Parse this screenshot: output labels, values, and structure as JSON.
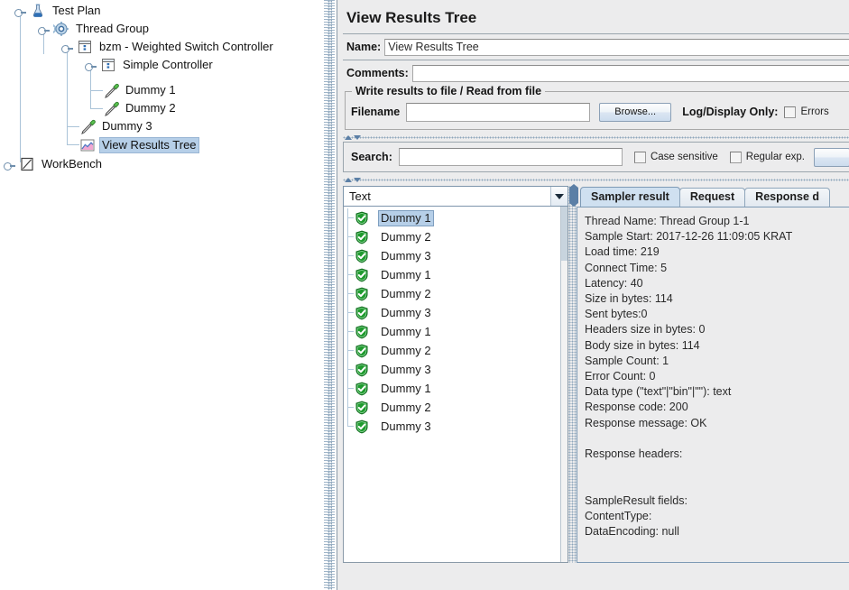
{
  "tree": {
    "nodes": [
      {
        "label": "Test Plan",
        "icon": "test-plan-icon",
        "depth": 0,
        "selected": false
      },
      {
        "label": "Thread Group",
        "icon": "thread-group-icon",
        "depth": 1,
        "selected": false
      },
      {
        "label": "bzm - Weighted Switch Controller",
        "icon": "controller-icon",
        "depth": 2,
        "selected": false
      },
      {
        "label": "Simple Controller",
        "icon": "controller-icon",
        "depth": 3,
        "selected": false
      },
      {
        "label": "Dummy  1",
        "icon": "dummy-sampler-icon",
        "depth": 4,
        "selected": false
      },
      {
        "label": "Dummy  2",
        "icon": "dummy-sampler-icon",
        "depth": 4,
        "selected": false
      },
      {
        "label": "Dummy  3",
        "icon": "dummy-sampler-icon",
        "depth": 3,
        "selected": false
      },
      {
        "label": "View Results Tree",
        "icon": "view-results-tree-icon",
        "depth": 3,
        "selected": true
      },
      {
        "label": "WorkBench",
        "icon": "workbench-icon",
        "depth": 0,
        "selected": false
      }
    ],
    "selection_color": "#b6cfe8"
  },
  "panel": {
    "title": "View Results Tree",
    "name_label": "Name:",
    "name_value": "View Results Tree",
    "comments_label": "Comments:",
    "comments_value": "",
    "file_group": {
      "title": "Write results to file / Read from file",
      "filename_label": "Filename",
      "filename_value": "",
      "browse_label": "Browse...",
      "log_display_label": "Log/Display Only:",
      "errors_label": "Errors",
      "errors_checked": false
    },
    "search": {
      "label": "Search:",
      "value": "",
      "case_sensitive_label": "Case sensitive",
      "case_sensitive_checked": false,
      "regular_exp_label": "Regular exp.",
      "regular_exp_checked": false
    },
    "renderer": {
      "selected": "Text"
    }
  },
  "results": {
    "items": [
      {
        "label": "Dummy  1",
        "status": "success",
        "selected": true
      },
      {
        "label": "Dummy  2",
        "status": "success",
        "selected": false
      },
      {
        "label": "Dummy  3",
        "status": "success",
        "selected": false
      },
      {
        "label": "Dummy  1",
        "status": "success",
        "selected": false
      },
      {
        "label": "Dummy  2",
        "status": "success",
        "selected": false
      },
      {
        "label": "Dummy  3",
        "status": "success",
        "selected": false
      },
      {
        "label": "Dummy  1",
        "status": "success",
        "selected": false
      },
      {
        "label": "Dummy  2",
        "status": "success",
        "selected": false
      },
      {
        "label": "Dummy  3",
        "status": "success",
        "selected": false
      },
      {
        "label": "Dummy  1",
        "status": "success",
        "selected": false
      },
      {
        "label": "Dummy  2",
        "status": "success",
        "selected": false
      },
      {
        "label": "Dummy  3",
        "status": "success",
        "selected": false
      }
    ]
  },
  "detail": {
    "tabs": [
      {
        "label": "Sampler result",
        "active": true
      },
      {
        "label": "Request",
        "active": false
      },
      {
        "label": "Response d",
        "active": false
      }
    ],
    "lines": [
      "Thread Name: Thread Group 1-1",
      "Sample Start: 2017-12-26 11:09:05 KRAT",
      "Load time: 219",
      "Connect Time: 5",
      "Latency: 40",
      "Size in bytes: 114",
      "Sent bytes:0",
      "Headers size in bytes: 0",
      "Body size in bytes: 114",
      "Sample Count: 1",
      "Error Count: 0",
      "Data type (\"text\"|\"bin\"|\"\"): text",
      "Response code: 200",
      "Response message: OK",
      "",
      "Response headers:",
      "",
      "",
      "SampleResult fields:",
      "ContentType:",
      "DataEncoding: null"
    ]
  }
}
